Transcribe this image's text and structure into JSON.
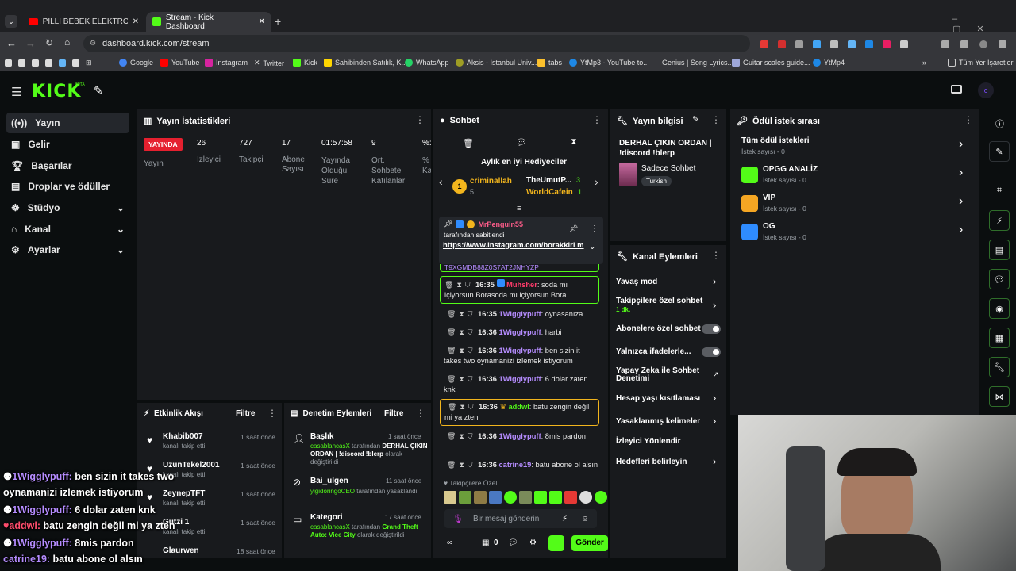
{
  "browser": {
    "tabs": [
      {
        "title": "PİLLİ BEBEK ELEKTROAKUSTİ"
      },
      {
        "title": "Stream - Kick Dashboard"
      }
    ],
    "url": "dashboard.kick.com/stream",
    "bookmarks": [
      "Google",
      "YouTube",
      "Instagram",
      "Twitter",
      "Kick",
      "Sahibinden Satılık, K...",
      "WhatsApp",
      "Aksis - İstanbul Üniv...",
      "tabs",
      "YtMp3 - YouTube to...",
      "Genius | Song Lyrics...",
      "Guitar scales guide...",
      "YtMp4",
      "Tüm Yer İşaretleri"
    ]
  },
  "kick": {
    "logo": "KICK",
    "beta": "BETA",
    "avatar": "c"
  },
  "sidebar": {
    "items": [
      {
        "label": "Yayın"
      },
      {
        "label": "Gelir"
      },
      {
        "label": "Başarılar"
      },
      {
        "label": "Droplar ve ödüller"
      },
      {
        "label": "Stüdyo"
      },
      {
        "label": "Kanal"
      },
      {
        "label": "Ayarlar"
      }
    ]
  },
  "stats": {
    "title": "Yayın İstatistikleri",
    "status_badge": "YAYINDA",
    "status_label": "Yayın",
    "items": [
      {
        "value": "26",
        "label": "İzleyici"
      },
      {
        "value": "727",
        "label": "Takipçi"
      },
      {
        "value": "17",
        "label": "Abone Sayısı"
      },
      {
        "value": "01:57:58",
        "label": "Yayında Olduğu Süre"
      },
      {
        "value": "9",
        "label": "Ort. Sohbete Katılanlar"
      },
      {
        "value": "%:",
        "label": "% Ka"
      }
    ]
  },
  "activity": {
    "title": "Etkinlik Akışı",
    "filter": "Filtre",
    "items": [
      {
        "name": "Khabib007",
        "sub": "kanalı takip etti",
        "time": "1 saat önce"
      },
      {
        "name": "UzunTekel2001",
        "sub": "kanalı takip etti",
        "time": "1 saat önce"
      },
      {
        "name": "ZeynepTFT",
        "sub": "kanalı takip etti",
        "time": "1 saat önce"
      },
      {
        "name": "Gutzi 1",
        "sub": "kanalı takip etti",
        "time": "1 saat önce"
      },
      {
        "name": "Glaurwen",
        "sub": "",
        "time": "18 saat önce"
      }
    ]
  },
  "moderation": {
    "title": "Denetim Eylemleri",
    "filter": "Filtre",
    "items": [
      {
        "title": "Başlık",
        "time": "1 saat önce",
        "actor": "casablancasX",
        "text1": "tarafından",
        "text2": "DERHAL ÇIKIN ORDAN | !discord !blerp",
        "text3": "olarak değiştirildi"
      },
      {
        "title": "Bai_ulgen",
        "time": "11 saat önce",
        "actor": "yigidoringoCEO",
        "text1": "tarafından",
        "text2": "",
        "text3": "yasaklandı"
      },
      {
        "title": "Kategori",
        "time": "17 saat önce",
        "actor": "casablancasX",
        "text1": "tarafından",
        "text2": "Grand Theft Auto: Vice City",
        "text3": "olarak değiştirildi"
      }
    ]
  },
  "chat": {
    "title": "Sohbet",
    "gifters_title": "Aylık en iyi Hediyeciler",
    "gifters": [
      {
        "name": "criminallah",
        "count": "5",
        "rank": "1"
      },
      {
        "name": "TheUmutP...",
        "count": "3"
      },
      {
        "name": "WorldCafein",
        "count": "1"
      }
    ],
    "pinned_by": "MrPenguin55",
    "pinned_text": "tarafından sabitlendi",
    "pinned_link": "https://www.instagram.com/borakkiri m",
    "pinned_tail": "T9XGMDB88Z0S7AT2JNHYZP",
    "messages": [
      {
        "time": "16:35",
        "user": "Muhsher",
        "text": "soda mı içiyorsun Borasoda mı içiyorsun Bora",
        "color": "#ff3b6b"
      },
      {
        "time": "16:35",
        "user": "1Wigglypuff",
        "text": "oynasanıza",
        "color": "#b58cff"
      },
      {
        "time": "16:36",
        "user": "1Wigglypuff",
        "text": "harbi",
        "color": "#b58cff"
      },
      {
        "time": "16:36",
        "user": "1Wigglypuff",
        "text": "ben sizin it takes two oynamanizi izlemek istiyorum",
        "color": "#b58cff"
      },
      {
        "time": "16:36",
        "user": "1Wigglypuff",
        "text": "6 dolar zaten knk",
        "color": "#b58cff"
      },
      {
        "time": "16:36",
        "user": "addwl",
        "text": "batu zengin değil mi ya zten",
        "color": "#53fc18"
      },
      {
        "time": "16:36",
        "user": "1Wigglypuff",
        "text": "8mis pardon",
        "color": "#b58cff"
      },
      {
        "time": "16:36",
        "user": "catrine19",
        "text": "batu abone ol alsın",
        "color": "#b58cff"
      }
    ],
    "followers_only": "Takipçilere Özel",
    "input_placeholder": "Bir mesaj gönderin",
    "send": "Gönder",
    "points": "0"
  },
  "streaminfo": {
    "title": "Yayın bilgisi",
    "stream_title": "DERHAL ÇIKIN ORDAN | !discord !blerp",
    "category": "Sadece Sohbet",
    "tag": "Turkish"
  },
  "channel_actions": {
    "title": "Kanal Eylemleri",
    "items": [
      {
        "label": "Yavaş mod"
      },
      {
        "label": "Takipçilere özel sohbet",
        "sub": "1 dk."
      },
      {
        "label": "Abonelere özel sohbet"
      },
      {
        "label": "Yalnızca ifadelerle..."
      },
      {
        "label": "Yapay Zeka ile Sohbet Denetimi"
      },
      {
        "label": "Hesap yaşı kısıtlaması"
      },
      {
        "label": "Yasaklanmış kelimeler"
      },
      {
        "label": "İzleyici Yönlendir"
      },
      {
        "label": "Hedefleri belirleyin"
      }
    ]
  },
  "rewards": {
    "title": "Ödül istek sırası",
    "items": [
      {
        "name": "Tüm ödül istekleri",
        "sub": "İstek sayısı - 0",
        "color": ""
      },
      {
        "name": "OPGG ANALİZ",
        "sub": "İstek sayısı - 0",
        "color": "#53fc18"
      },
      {
        "name": "VIP",
        "sub": "İstek sayısı - 0",
        "color": "#f5a623"
      },
      {
        "name": "OG",
        "sub": "İstek sayısı - 0",
        "color": "#2f8cff"
      }
    ]
  },
  "overlay": [
    {
      "user": "1Wigglypuff:",
      "text": "ben sizin it takes two",
      "color": "#b58cff"
    },
    {
      "user": "",
      "text": "oynamanizi izlemek istiyorum",
      "color": "#fff"
    },
    {
      "user": "1Wigglypuff:",
      "text": "6 dolar zaten knk",
      "color": "#b58cff"
    },
    {
      "user": "addwl:",
      "text": "batu zengin değil mi ya zten",
      "color": "#ff4d6d"
    },
    {
      "user": "1Wigglypuff:",
      "text": "8mis pardon",
      "color": "#b58cff"
    },
    {
      "user": "catrine19:",
      "text": "batu abone ol alsın",
      "color": "#b58cff"
    }
  ]
}
